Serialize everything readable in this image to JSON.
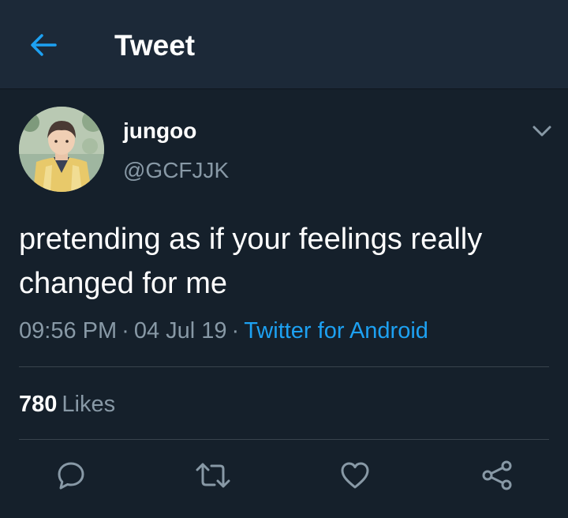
{
  "header": {
    "back_icon": "arrow-left-icon",
    "title": "Tweet",
    "accent_color": "#1da1f2"
  },
  "tweet": {
    "display_name": "jungoo",
    "handle": "@GCFJJK",
    "text": "pretending as if your feelings really changed for me",
    "time": "09:56 PM",
    "separator": "·",
    "date": "04 Jul 19",
    "source": "Twitter for Android",
    "likes_count": "780",
    "likes_label": "Likes",
    "caret_icon": "chevron-down-icon"
  },
  "actions": [
    {
      "icon": "reply-icon"
    },
    {
      "icon": "retweet-icon"
    },
    {
      "icon": "like-heart-icon"
    },
    {
      "icon": "share-icon"
    }
  ],
  "colors": {
    "background": "#15202b",
    "header_background": "#1c2938",
    "secondary_text": "#8899a6",
    "link": "#1da1f2",
    "divider": "#38444d"
  }
}
